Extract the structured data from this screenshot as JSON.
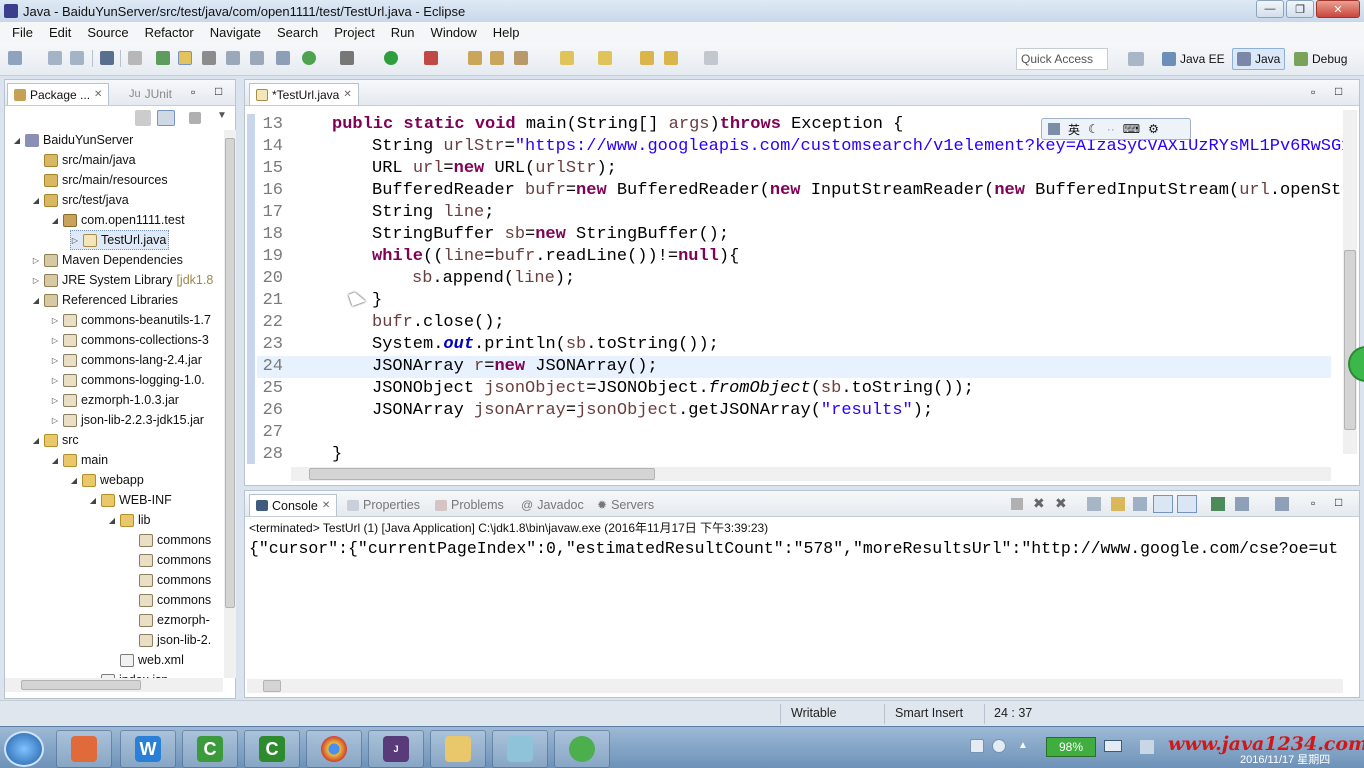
{
  "window": {
    "title": "Java - BaiduYunServer/src/test/java/com/open1111/test/TestUrl.java - Eclipse"
  },
  "menu": [
    "File",
    "Edit",
    "Source",
    "Refactor",
    "Navigate",
    "Search",
    "Project",
    "Run",
    "Window",
    "Help"
  ],
  "toolbar": {
    "quick_access": "Quick Access",
    "perspectives": [
      "Java EE",
      "Java",
      "Debug"
    ]
  },
  "explorer": {
    "tabs": [
      "Package ...",
      "JUnit"
    ],
    "tree": [
      {
        "label": "BaiduYunServer",
        "icon": "project",
        "twisty": "open"
      },
      {
        "label": "src/main/java",
        "icon": "source-folder",
        "twisty": ""
      },
      {
        "label": "src/main/resources",
        "icon": "source-folder",
        "twisty": ""
      },
      {
        "label": "src/test/java",
        "icon": "source-folder",
        "twisty": "open"
      },
      {
        "label": "com.open1111.test",
        "icon": "package",
        "twisty": "open"
      },
      {
        "label": "TestUrl.java",
        "icon": "java-file",
        "twisty": "closed"
      },
      {
        "label": "Maven Dependencies",
        "icon": "library",
        "twisty": "closed"
      },
      {
        "label": "JRE System Library",
        "extra": "[jdk1.8",
        "icon": "library",
        "twisty": "closed"
      },
      {
        "label": "Referenced Libraries",
        "icon": "library",
        "twisty": "open"
      },
      {
        "label": "commons-beanutils-1.7",
        "icon": "jar",
        "twisty": "closed"
      },
      {
        "label": "commons-collections-3",
        "icon": "jar",
        "twisty": "closed"
      },
      {
        "label": "commons-lang-2.4.jar",
        "icon": "jar",
        "twisty": "closed"
      },
      {
        "label": "commons-logging-1.0.",
        "icon": "jar",
        "twisty": "closed"
      },
      {
        "label": "ezmorph-1.0.3.jar",
        "icon": "jar",
        "twisty": "closed"
      },
      {
        "label": "json-lib-2.2.3-jdk15.jar",
        "icon": "jar",
        "twisty": "closed"
      },
      {
        "label": "src",
        "icon": "folder",
        "twisty": "open"
      },
      {
        "label": "main",
        "icon": "folder",
        "twisty": "open"
      },
      {
        "label": "webapp",
        "icon": "folder",
        "twisty": "open"
      },
      {
        "label": "WEB-INF",
        "icon": "folder",
        "twisty": "open"
      },
      {
        "label": "lib",
        "icon": "folder",
        "twisty": "open"
      },
      {
        "label": "commons",
        "icon": "jar",
        "twisty": ""
      },
      {
        "label": "commons",
        "icon": "jar",
        "twisty": ""
      },
      {
        "label": "commons",
        "icon": "jar",
        "twisty": ""
      },
      {
        "label": "commons",
        "icon": "jar",
        "twisty": ""
      },
      {
        "label": "ezmorph-",
        "icon": "jar",
        "twisty": ""
      },
      {
        "label": "json-lib-2.",
        "icon": "jar",
        "twisty": ""
      },
      {
        "label": "web.xml",
        "icon": "xml",
        "twisty": ""
      },
      {
        "label": "index.jsp",
        "icon": "xml",
        "twisty": ""
      }
    ]
  },
  "editor": {
    "tab": "*TestUrl.java",
    "current_line": "24",
    "lines": [
      {
        "n": "13",
        "indent": 0,
        "tokens": [
          [
            "kw",
            "public static void "
          ],
          [
            "",
            "main(String[] "
          ],
          [
            "var",
            "args"
          ],
          [
            "",
            ")"
          ],
          [
            "kw",
            "throws "
          ],
          [
            "",
            "Exception {"
          ]
        ]
      },
      {
        "n": "14",
        "indent": 1,
        "tokens": [
          [
            "",
            "String "
          ],
          [
            "var",
            "urlStr"
          ],
          [
            "",
            "="
          ],
          [
            "str",
            "\"https://www.googleapis.com/customsearch/v1element?key=AIzaSyCVAXiUzRYsML1Pv6RwSG1"
          ]
        ]
      },
      {
        "n": "15",
        "indent": 1,
        "tokens": [
          [
            "",
            "URL "
          ],
          [
            "var",
            "url"
          ],
          [
            "",
            "="
          ],
          [
            "kw",
            "new "
          ],
          [
            "",
            "URL("
          ],
          [
            "var",
            "urlStr"
          ],
          [
            "",
            ");"
          ]
        ]
      },
      {
        "n": "16",
        "indent": 1,
        "tokens": [
          [
            "",
            "BufferedReader "
          ],
          [
            "var",
            "bufr"
          ],
          [
            "",
            "="
          ],
          [
            "kw",
            "new "
          ],
          [
            "",
            "BufferedReader("
          ],
          [
            "kw",
            "new "
          ],
          [
            "",
            "InputStreamReader("
          ],
          [
            "kw",
            "new "
          ],
          [
            "",
            "BufferedInputStream("
          ],
          [
            "var",
            "url"
          ],
          [
            "",
            ".openStr"
          ]
        ]
      },
      {
        "n": "17",
        "indent": 1,
        "tokens": [
          [
            "",
            "String "
          ],
          [
            "var",
            "line"
          ],
          [
            "",
            ";"
          ]
        ]
      },
      {
        "n": "18",
        "indent": 1,
        "tokens": [
          [
            "",
            "StringBuffer "
          ],
          [
            "var",
            "sb"
          ],
          [
            "",
            "="
          ],
          [
            "kw",
            "new "
          ],
          [
            "",
            "StringBuffer();"
          ]
        ]
      },
      {
        "n": "19",
        "indent": 1,
        "tokens": [
          [
            "kw",
            "while"
          ],
          [
            "",
            "(("
          ],
          [
            "var",
            "line"
          ],
          [
            "",
            "="
          ],
          [
            "var",
            "bufr"
          ],
          [
            "",
            ".readLine())!="
          ],
          [
            "kw",
            "null"
          ],
          [
            "",
            "){"
          ]
        ]
      },
      {
        "n": "20",
        "indent": 2,
        "tokens": [
          [
            "var",
            "sb"
          ],
          [
            "",
            ".append("
          ],
          [
            "var",
            "line"
          ],
          [
            "",
            ");"
          ]
        ]
      },
      {
        "n": "21",
        "indent": 1,
        "tokens": [
          [
            "",
            "}"
          ]
        ]
      },
      {
        "n": "22",
        "indent": 1,
        "tokens": [
          [
            "var",
            "bufr"
          ],
          [
            "",
            ".close();"
          ]
        ]
      },
      {
        "n": "23",
        "indent": 1,
        "tokens": [
          [
            "",
            "System."
          ],
          [
            "fld",
            "out"
          ],
          [
            "",
            ".println("
          ],
          [
            "var",
            "sb"
          ],
          [
            "",
            ".toString());"
          ]
        ]
      },
      {
        "n": "24",
        "indent": 1,
        "tokens": [
          [
            "",
            "JSONArray "
          ],
          [
            "var",
            "r"
          ],
          [
            "",
            "="
          ],
          [
            "kw",
            "new "
          ],
          [
            "",
            "JSONArray();"
          ]
        ]
      },
      {
        "n": "25",
        "indent": 1,
        "tokens": [
          [
            "",
            "JSONObject "
          ],
          [
            "var",
            "jsonObject"
          ],
          [
            "",
            "=JSONObject."
          ],
          [
            "it",
            "fromObject"
          ],
          [
            "",
            "("
          ],
          [
            "var",
            "sb"
          ],
          [
            "",
            ".toString());"
          ]
        ]
      },
      {
        "n": "26",
        "indent": 1,
        "tokens": [
          [
            "",
            "JSONArray "
          ],
          [
            "var",
            "jsonArray"
          ],
          [
            "",
            "="
          ],
          [
            "var",
            "jsonObject"
          ],
          [
            "",
            ".getJSONArray("
          ],
          [
            "str",
            "\"results\""
          ],
          [
            "",
            ");"
          ]
        ]
      },
      {
        "n": "27",
        "indent": 0,
        "tokens": []
      },
      {
        "n": "28",
        "indent": 0,
        "tokens": [
          [
            "",
            "}"
          ]
        ]
      }
    ],
    "ime_label": "英"
  },
  "console": {
    "tabs": [
      "Console",
      "Properties",
      "Problems",
      "Javadoc",
      "Servers"
    ],
    "terminated": "<terminated> TestUrl (1) [Java Application] C:\\jdk1.8\\bin\\javaw.exe (2016年11月17日 下午3:39:23)",
    "output": "{\"cursor\":{\"currentPageIndex\":0,\"estimatedResultCount\":\"578\",\"moreResultsUrl\":\"http://www.google.com/cse?oe=ut"
  },
  "status": {
    "writable": "Writable",
    "insert_mode": "Smart Insert",
    "position": "24 : 37"
  },
  "taskbar": {
    "battery": "98%",
    "watermark": "www.java1234.com",
    "date": "2016/11/17 星期四"
  },
  "colors": {
    "keyword": "#7f0055",
    "string": "#2a00ff",
    "variable": "#6a3e3e",
    "current_line": "#e8f2fe"
  }
}
